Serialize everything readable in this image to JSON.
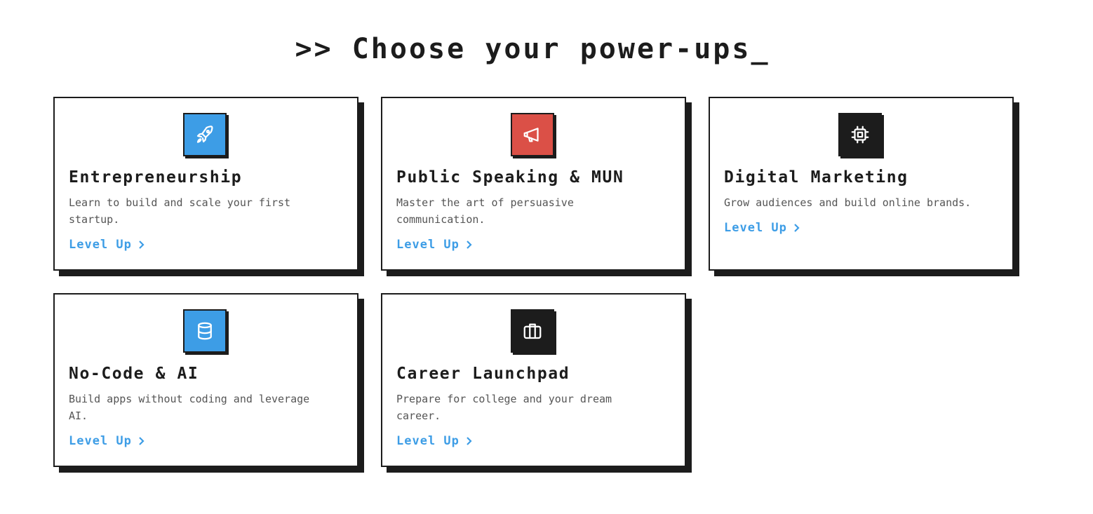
{
  "page": {
    "title": ">> Choose your power-ups_"
  },
  "colors": {
    "blue": "#3d9de6",
    "red": "#db5047",
    "black": "#1c1c1c",
    "border": "#1c1c1c",
    "link": "#3d9de6"
  },
  "cards": [
    {
      "title": "Entrepreneurship",
      "description": "Learn to build and scale your first startup.",
      "link_label": "Level Up",
      "icon": "rocket-icon",
      "icon_bg": "#3d9de6"
    },
    {
      "title": "Public Speaking & MUN",
      "description": "Master the art of persuasive communication.",
      "link_label": "Level Up",
      "icon": "megaphone-icon",
      "icon_bg": "#db5047"
    },
    {
      "title": "Digital Marketing",
      "description": "Grow audiences and build online brands.",
      "link_label": "Level Up",
      "icon": "chip-icon",
      "icon_bg": "#1c1c1c"
    },
    {
      "title": "No-Code & AI",
      "description": "Build apps without coding and leverage AI.",
      "link_label": "Level Up",
      "icon": "database-icon",
      "icon_bg": "#3d9de6"
    },
    {
      "title": "Career Launchpad",
      "description": "Prepare for college and your dream career.",
      "link_label": "Level Up",
      "icon": "briefcase-icon",
      "icon_bg": "#1c1c1c"
    }
  ]
}
